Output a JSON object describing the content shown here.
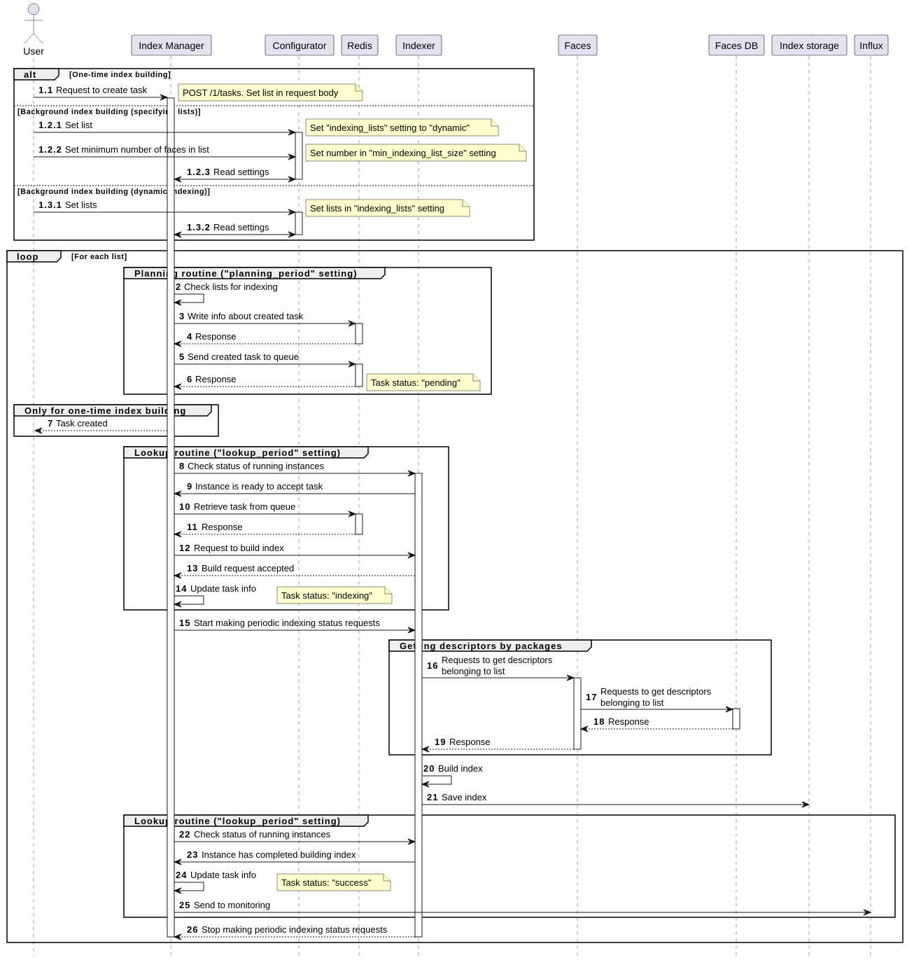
{
  "diagram": {
    "type": "sequence",
    "participants": [
      {
        "id": "user",
        "label": "User",
        "kind": "actor"
      },
      {
        "id": "im",
        "label": "Index Manager",
        "kind": "participant"
      },
      {
        "id": "cfg",
        "label": "Configurator",
        "kind": "participant"
      },
      {
        "id": "redis",
        "label": "Redis",
        "kind": "participant"
      },
      {
        "id": "idx",
        "label": "Indexer",
        "kind": "participant"
      },
      {
        "id": "faces",
        "label": "Faces",
        "kind": "participant"
      },
      {
        "id": "fdb",
        "label": "Faces DB",
        "kind": "participant"
      },
      {
        "id": "istore",
        "label": "Index storage",
        "kind": "participant"
      },
      {
        "id": "influx",
        "label": "Influx",
        "kind": "participant"
      }
    ],
    "frames": [
      {
        "id": "alt",
        "kind": "alt",
        "title": "alt",
        "guard": "[One-time index building]",
        "sections": [
          "[Background index building (specifying lists)]",
          "[Background index building (dynamic indexing)]"
        ]
      },
      {
        "id": "loop",
        "kind": "loop",
        "title": "loop",
        "guard": "[For each list]"
      },
      {
        "id": "planning",
        "kind": "group",
        "title": "Planning routine (\"planning_period\" setting)"
      },
      {
        "id": "onetime",
        "kind": "group",
        "title": "Only for one-time index building"
      },
      {
        "id": "lookup1",
        "kind": "group",
        "title": "Lookup routine (\"lookup_period\" setting)"
      },
      {
        "id": "packages",
        "kind": "group",
        "title": "Getting descriptors by packages"
      },
      {
        "id": "lookup2",
        "kind": "group",
        "title": "Lookup routine (\"lookup_period\" setting)"
      }
    ],
    "messages": [
      {
        "num": "1.1",
        "text": "Request to create task",
        "from": "user",
        "to": "im",
        "style": "solid"
      },
      {
        "num": "1.2.1",
        "text": "Set list",
        "from": "user",
        "to": "cfg",
        "style": "solid"
      },
      {
        "num": "1.2.2",
        "text": "Set minimum number of faces in list",
        "from": "user",
        "to": "cfg",
        "style": "solid"
      },
      {
        "num": "1.2.3",
        "text": "Read settings",
        "from": "cfg",
        "to": "im",
        "style": "bidirectional"
      },
      {
        "num": "1.3.1",
        "text": "Set lists",
        "from": "user",
        "to": "cfg",
        "style": "solid"
      },
      {
        "num": "1.3.2",
        "text": "Read settings",
        "from": "cfg",
        "to": "im",
        "style": "bidirectional"
      },
      {
        "num": "2",
        "text": "Check lists for indexing",
        "from": "im",
        "to": "im",
        "style": "self"
      },
      {
        "num": "3",
        "text": "Write info about created task",
        "from": "im",
        "to": "redis",
        "style": "solid"
      },
      {
        "num": "4",
        "text": "Response",
        "from": "redis",
        "to": "im",
        "style": "dotted"
      },
      {
        "num": "5",
        "text": "Send created task to queue",
        "from": "im",
        "to": "redis",
        "style": "solid"
      },
      {
        "num": "6",
        "text": "Response",
        "from": "redis",
        "to": "im",
        "style": "dotted"
      },
      {
        "num": "7",
        "text": "Task created",
        "from": "im",
        "to": "user",
        "style": "dotted"
      },
      {
        "num": "8",
        "text": "Check status of running instances",
        "from": "im",
        "to": "idx",
        "style": "solid"
      },
      {
        "num": "9",
        "text": "Instance is ready to accept task",
        "from": "idx",
        "to": "im",
        "style": "solid"
      },
      {
        "num": "10",
        "text": "Retrieve task from queue",
        "from": "im",
        "to": "redis",
        "style": "solid"
      },
      {
        "num": "11",
        "text": "Response",
        "from": "redis",
        "to": "im",
        "style": "dotted"
      },
      {
        "num": "12",
        "text": "Request to build index",
        "from": "im",
        "to": "idx",
        "style": "solid"
      },
      {
        "num": "13",
        "text": "Build request accepted",
        "from": "idx",
        "to": "im",
        "style": "dotted"
      },
      {
        "num": "14",
        "text": "Update task info",
        "from": "im",
        "to": "im",
        "style": "self"
      },
      {
        "num": "15",
        "text": "Start making periodic indexing status requests",
        "from": "im",
        "to": "idx",
        "style": "solid"
      },
      {
        "num": "16",
        "text": "Requests to get descriptors",
        "text2": "belonging to list",
        "from": "idx",
        "to": "faces",
        "style": "solid"
      },
      {
        "num": "17",
        "text": "Requests to get descriptors",
        "text2": "belonging to list",
        "from": "faces",
        "to": "fdb",
        "style": "solid"
      },
      {
        "num": "18",
        "text": "Response",
        "from": "fdb",
        "to": "faces",
        "style": "dotted"
      },
      {
        "num": "19",
        "text": "Response",
        "from": "faces",
        "to": "idx",
        "style": "dotted"
      },
      {
        "num": "20",
        "text": "Build index",
        "from": "idx",
        "to": "idx",
        "style": "self"
      },
      {
        "num": "21",
        "text": "Save index",
        "from": "idx",
        "to": "istore",
        "style": "solid"
      },
      {
        "num": "22",
        "text": "Check status of running instances",
        "from": "im",
        "to": "idx",
        "style": "solid"
      },
      {
        "num": "23",
        "text": "Instance has completed building index",
        "from": "idx",
        "to": "im",
        "style": "solid"
      },
      {
        "num": "24",
        "text": "Update task info",
        "from": "im",
        "to": "im",
        "style": "self"
      },
      {
        "num": "25",
        "text": "Send to monitoring",
        "from": "im",
        "to": "influx",
        "style": "solid"
      },
      {
        "num": "26",
        "text": "Stop making periodic indexing status requests",
        "from": "idx",
        "to": "im",
        "style": "dotted"
      }
    ],
    "notes": [
      {
        "id": "n1",
        "text": "POST /1/tasks. Set list in request body"
      },
      {
        "id": "n2",
        "text": "Set \"indexing_lists\" setting to \"dynamic\""
      },
      {
        "id": "n3",
        "text": "Set number in \"min_indexing_list_size\" setting"
      },
      {
        "id": "n4",
        "text": "Set lists in \"indexing_lists\" setting"
      },
      {
        "id": "n5",
        "text": "Task status: \"pending\""
      },
      {
        "id": "n6",
        "text": "Task status: \"indexing\""
      },
      {
        "id": "n7",
        "text": "Task status: \"success\""
      }
    ]
  }
}
